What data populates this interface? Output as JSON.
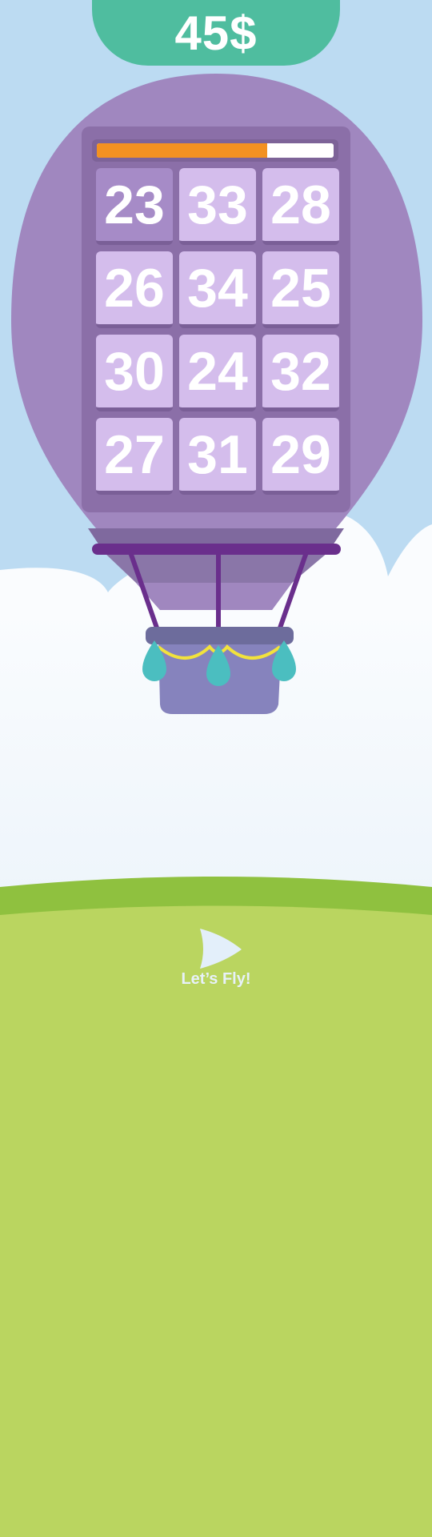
{
  "header": {
    "price": "45$"
  },
  "progress": {
    "fill_fraction": 0.72,
    "fill_color": "#f39121"
  },
  "tiles": [
    "23",
    "33",
    "28",
    "26",
    "34",
    "25",
    "30",
    "24",
    "32",
    "27",
    "31",
    "29"
  ],
  "selected_tile_index": 0,
  "play_button": {
    "label": "Let’s Fly!",
    "icon": "paper-plane-icon"
  },
  "colors": {
    "sky": "#bcdbf2",
    "balloon": "#a087bf",
    "badge": "#4fbd9f",
    "grass": "#bad560",
    "grass_dark": "#8fc13f"
  }
}
